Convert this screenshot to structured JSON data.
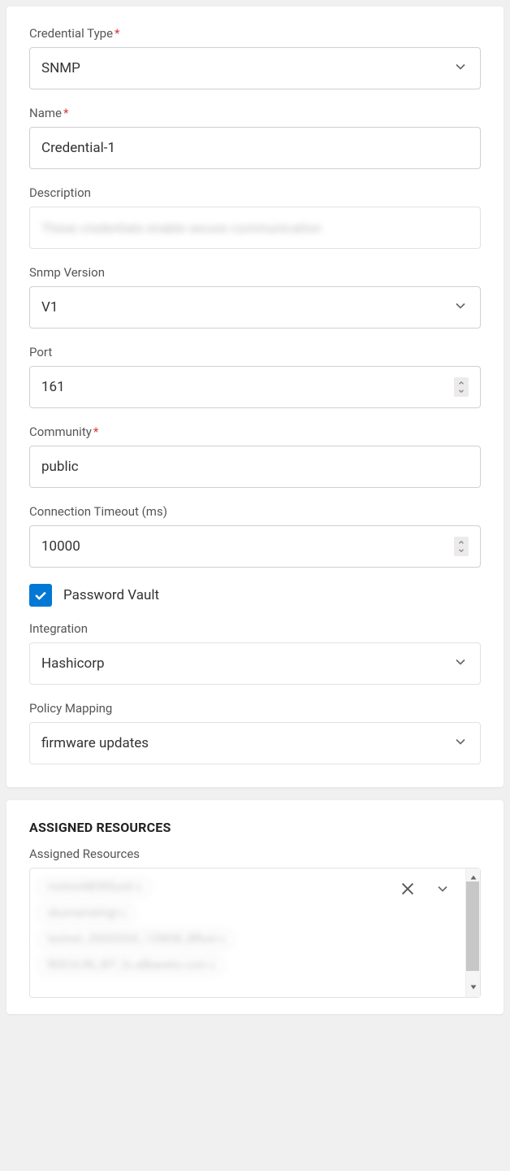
{
  "form": {
    "credentialType": {
      "label": "Credential Type",
      "required": true,
      "value": "SNMP"
    },
    "name": {
      "label": "Name",
      "required": true,
      "value": "Credential-1"
    },
    "description": {
      "label": "Description",
      "required": false,
      "value": "These credentials enable secure communication"
    },
    "snmpVersion": {
      "label": "Snmp Version",
      "required": false,
      "value": "V1"
    },
    "port": {
      "label": "Port",
      "required": false,
      "value": "161"
    },
    "community": {
      "label": "Community",
      "required": true,
      "value": "public"
    },
    "timeout": {
      "label": "Connection Timeout (ms)",
      "required": false,
      "value": "10000"
    },
    "passwordVault": {
      "label": "Password Vault",
      "checked": true
    },
    "integration": {
      "label": "Integration",
      "required": false,
      "value": "Hashicorp"
    },
    "policyMapping": {
      "label": "Policy Mapping",
      "required": false,
      "value": "firmware updates"
    }
  },
  "resources": {
    "heading": "ASSIGNED RESOURCES",
    "label": "Assigned Resources",
    "items": [
      "motionNEWSunit x",
      "skumametrigt x",
      "testnet_20042020_120838_Bflunt x",
      "RISCA/IN_WT_fo.allbanets.com x"
    ]
  }
}
